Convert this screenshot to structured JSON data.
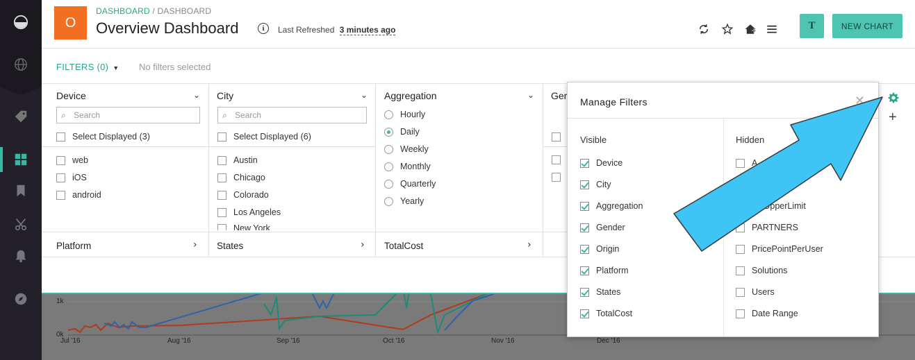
{
  "header": {
    "logo_letter": "O",
    "breadcrumb_link": "DASHBOARD",
    "breadcrumb_sep": " / ",
    "breadcrumb_current": "DASHBOARD",
    "title": "Overview Dashboard",
    "info_glyph": "i",
    "refreshed_label": "Last Refreshed",
    "refreshed_ago": "3 minutes ago",
    "user_initial": "T",
    "new_chart_label": "NEW CHART"
  },
  "filters_bar": {
    "toggle_label": "FILTERS (0)",
    "status": "No filters selected"
  },
  "filter_columns": {
    "device": {
      "title": "Device",
      "search_placeholder": "Search",
      "select_displayed": "Select Displayed (3)",
      "options": [
        "web",
        "iOS",
        "android"
      ]
    },
    "city": {
      "title": "City",
      "search_placeholder": "Search",
      "select_displayed": "Select Displayed (6)",
      "options": [
        "Austin",
        "Chicago",
        "Colorado",
        "Los Angeles",
        "New York"
      ]
    },
    "aggregation": {
      "title": "Aggregation",
      "options": [
        "Hourly",
        "Daily",
        "Weekly",
        "Monthly",
        "Quarterly",
        "Yearly"
      ],
      "selected": "Daily"
    },
    "gender_partial": "Ger"
  },
  "filter_footers": {
    "platform": "Platform",
    "states": "States",
    "totalcost": "TotalCost"
  },
  "manage_filters": {
    "title": "Manage Filters",
    "visible_title": "Visible",
    "hidden_title": "Hidden",
    "visible": [
      "Device",
      "City",
      "Aggregation",
      "Gender",
      "Origin",
      "Platform",
      "States",
      "TotalCost"
    ],
    "hidden_partial": [
      "A",
      "...imit",
      "...eUpperLimit"
    ],
    "hidden": [
      "PARTNERS",
      "PricePointPerUser",
      "Solutions",
      "Users",
      "Date Range"
    ]
  },
  "chart_ticks": {
    "y": [
      "1k",
      "0k"
    ],
    "x": [
      "Jul '16",
      "Aug '16",
      "Sep '16",
      "Oct '16",
      "Nov '16",
      "Dec '16"
    ]
  },
  "colors": {
    "accent": "#36b8a3",
    "brand_orange": "#f26f21",
    "arrow": "#3ec4f5",
    "sidebar": "#24202a"
  }
}
